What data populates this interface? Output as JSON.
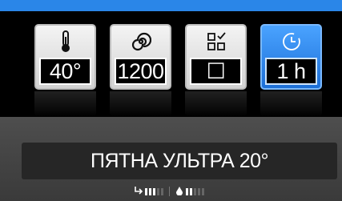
{
  "tiles": [
    {
      "name": "temperature",
      "icon": "thermometer-icon",
      "value": "40°",
      "active": false
    },
    {
      "name": "spin",
      "icon": "spiral-icon",
      "value": "1200",
      "active": false
    },
    {
      "name": "options",
      "icon": "options-grid-icon",
      "value": "☐",
      "active": false
    },
    {
      "name": "timer",
      "icon": "clock-icon",
      "value": "1 h",
      "active": true
    }
  ],
  "program": {
    "label": "ПЯТНА УЛЬТРА 20°"
  },
  "indicators": {
    "spin_icon": "spin-arrow-icon",
    "spin_levels": {
      "on": 3,
      "total": 5
    },
    "water_icon": "water-drop-icon",
    "water_levels": {
      "on": 2,
      "total": 5
    }
  },
  "colors": {
    "accent": "#2a86e8",
    "active_tile": "#1c6fd8"
  }
}
